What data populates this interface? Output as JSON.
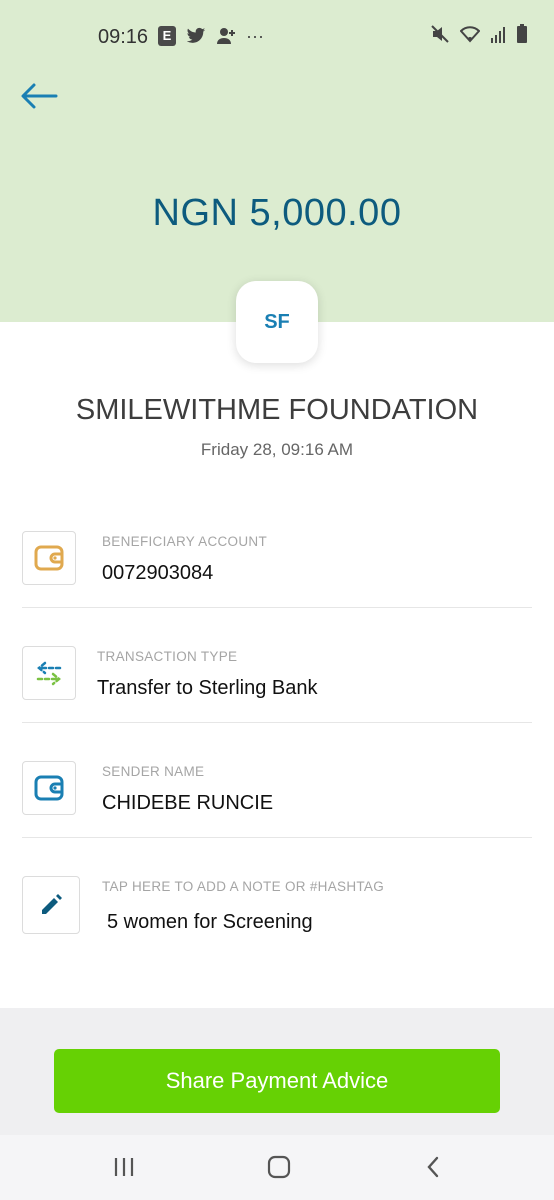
{
  "status_bar": {
    "time": "09:16",
    "e_badge": "E",
    "more": "···"
  },
  "header": {
    "amount": "NGN 5,000.00"
  },
  "avatar": {
    "initials": "SF"
  },
  "merchant": {
    "name": "SMILEWITHME FOUNDATION",
    "date": "Friday 28, 09:16 AM"
  },
  "details": [
    {
      "label": "BENEFICIARY ACCOUNT",
      "value": "0072903084",
      "icon": "wallet-icon"
    },
    {
      "label": "TRANSACTION TYPE",
      "value": "Transfer to Sterling Bank",
      "icon": "transfer-arrows-icon"
    },
    {
      "label": "SENDER NAME",
      "value": "CHIDEBE RUNCIE",
      "icon": "wallet-icon"
    },
    {
      "label": "TAP HERE TO ADD A NOTE OR #HASHTAG",
      "value": "5 women for Screening",
      "icon": "pencil-icon"
    }
  ],
  "actions": {
    "share_label": "Share Payment Advice"
  },
  "colors": {
    "header_bg": "#dcecd0",
    "amount": "#0d5b7e",
    "accent_blue": "#1a7fb3",
    "wallet_orange": "#e0a94f",
    "button_green": "#66d104"
  }
}
